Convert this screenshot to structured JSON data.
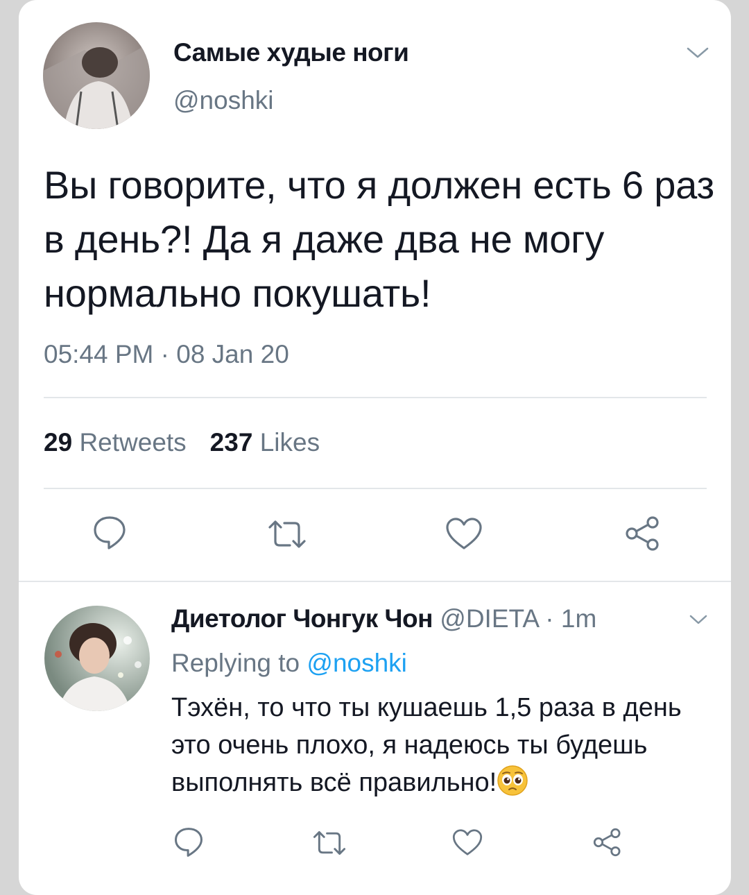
{
  "main_tweet": {
    "display_name": "Самые худые ноги",
    "handle": "@noshki",
    "text": "Вы говорите, что я должен есть 6 раз в день?! Да я даже два не могу нормально покушать!",
    "timestamp": "05:44 PM · 08 Jan 20",
    "retweets_count": "29",
    "retweets_label": "Retweets",
    "likes_count": "237",
    "likes_label": "Likes"
  },
  "reply": {
    "display_name": "Диетолог Чонгук Чон",
    "handle": "@DIETA",
    "time": "· 1m",
    "replying_label": "Replying to",
    "replying_handle": "@noshki",
    "text": "Тэхён, то что ты кушаешь 1,5 раза в день это очень плохо, я надеюсь ты будешь выполнять всё правильно!"
  },
  "icons": {
    "reply": "reply-icon",
    "retweet": "retweet-icon",
    "like": "heart-icon",
    "share": "share-icon",
    "menu": "chevron-down-icon",
    "emoji": "pleading-face-emoji"
  },
  "colors": {
    "text": "#141823",
    "secondary": "#687684",
    "link": "#1da1f2",
    "divider": "#e3e6e9"
  }
}
